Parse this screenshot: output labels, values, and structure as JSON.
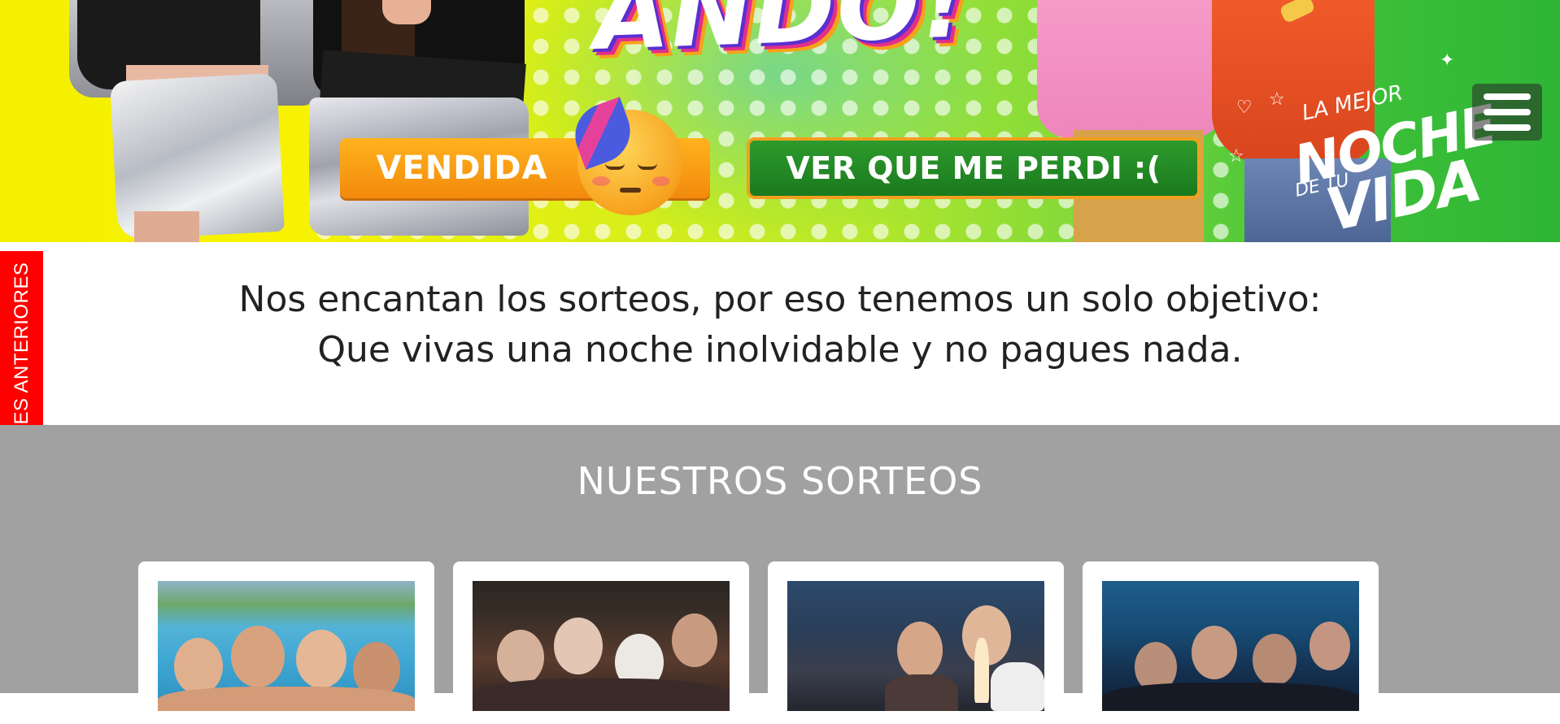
{
  "hero": {
    "title_fragment": "ANDO!",
    "sold_label": "VENDIDA",
    "lost_button_label": "VER QUE ME PERDI :(",
    "slogan": {
      "line1": "LA MEJOR",
      "line2": "NOCHE",
      "line3": "DE TU",
      "line4": "VIDA"
    },
    "emoji_icon": "partying-sad-face-emoji",
    "menu_icon": "hamburger-menu-icon"
  },
  "side_tab": {
    "label": "GANADORES ANTERIORES",
    "color": "#ff0000"
  },
  "intro": {
    "line1": "Nos encantan los sorteos, por eso tenemos un solo objetivo:",
    "line2": "Que vivas una noche inolvidable y no pagues nada."
  },
  "raffles": {
    "heading": "NUESTROS SORTEOS",
    "background_color": "#a1a1a1",
    "cards": [
      {
        "image": "pool-party-photo"
      },
      {
        "image": "costume-party-photo"
      },
      {
        "image": "dinner-toast-photo"
      },
      {
        "image": "nightclub-crowd-photo"
      }
    ]
  },
  "colors": {
    "sold_orange": "#f28a0c",
    "lost_green": "#1a7a1e",
    "lost_border": "#f2a01e"
  }
}
